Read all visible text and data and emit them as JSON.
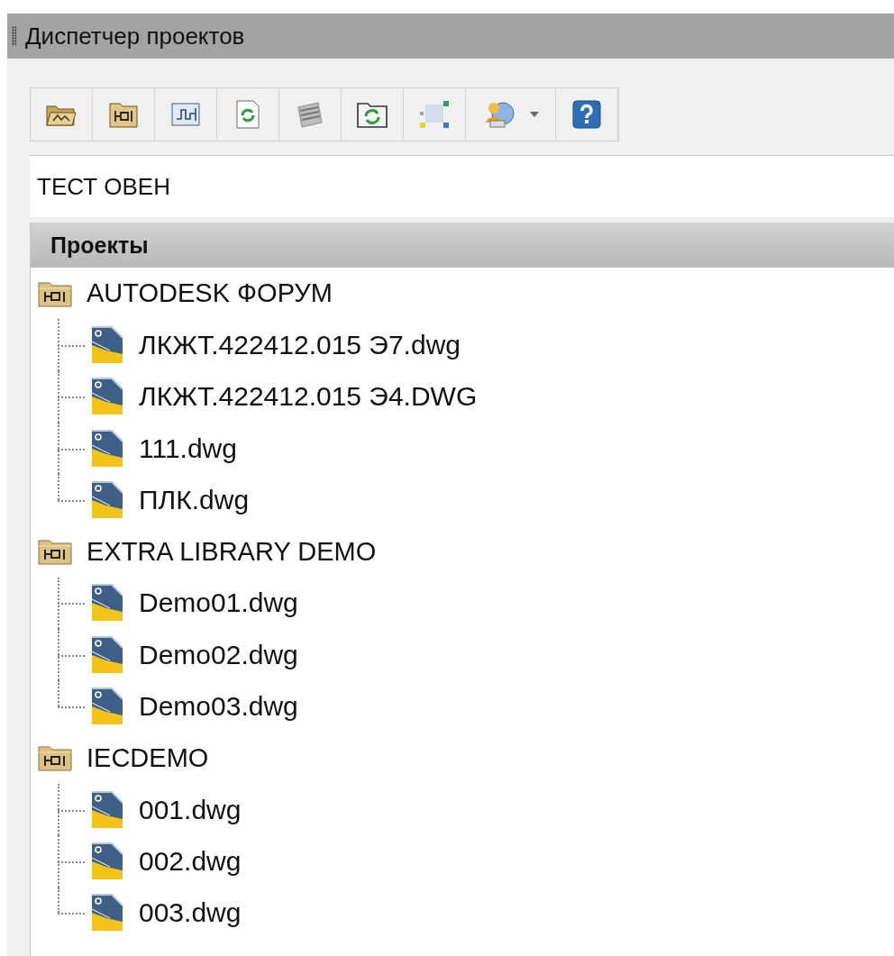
{
  "panel": {
    "title": "Диспетчер проектов"
  },
  "active_project": {
    "value": "ТЕСТ ОВЕН"
  },
  "tree": {
    "header": "Проекты",
    "projects": [
      {
        "name": "AUTODESK ФОРУМ",
        "children": [
          {
            "name": "ЛКЖТ.422412.015 Э7.dwg"
          },
          {
            "name": "ЛКЖТ.422412.015 Э4.DWG"
          },
          {
            "name": "111.dwg"
          },
          {
            "name": "ПЛК.dwg"
          }
        ]
      },
      {
        "name": "EXTRA LIBRARY DEMO",
        "children": [
          {
            "name": "Demo01.dwg"
          },
          {
            "name": "Demo02.dwg"
          },
          {
            "name": "Demo03.dwg"
          }
        ]
      },
      {
        "name": "IECDEMO",
        "children": [
          {
            "name": "001.dwg"
          },
          {
            "name": "002.dwg"
          },
          {
            "name": "003.dwg"
          }
        ]
      }
    ]
  }
}
